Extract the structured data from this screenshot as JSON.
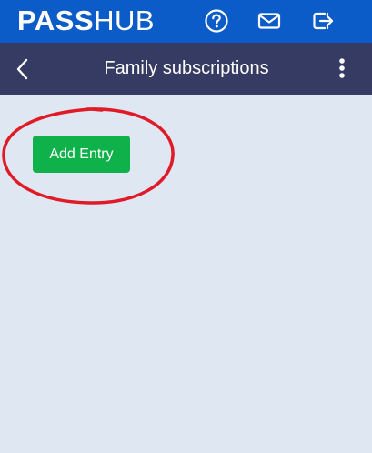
{
  "header": {
    "logo_bold": "PASS",
    "logo_light": "HUB",
    "help_icon": "help-circle-icon",
    "mail_icon": "mail-icon",
    "logout_icon": "logout-icon",
    "color": "#0b5bc8"
  },
  "navbar": {
    "back_icon": "chevron-left-icon",
    "title": "Family subscriptions",
    "menu_icon": "kebab-menu-icon",
    "color": "#353b62"
  },
  "main": {
    "add_entry_label": "Add Entry",
    "button_color": "#0fb14a",
    "annotation_color": "#e01a26",
    "background": "#dfe8f2"
  }
}
